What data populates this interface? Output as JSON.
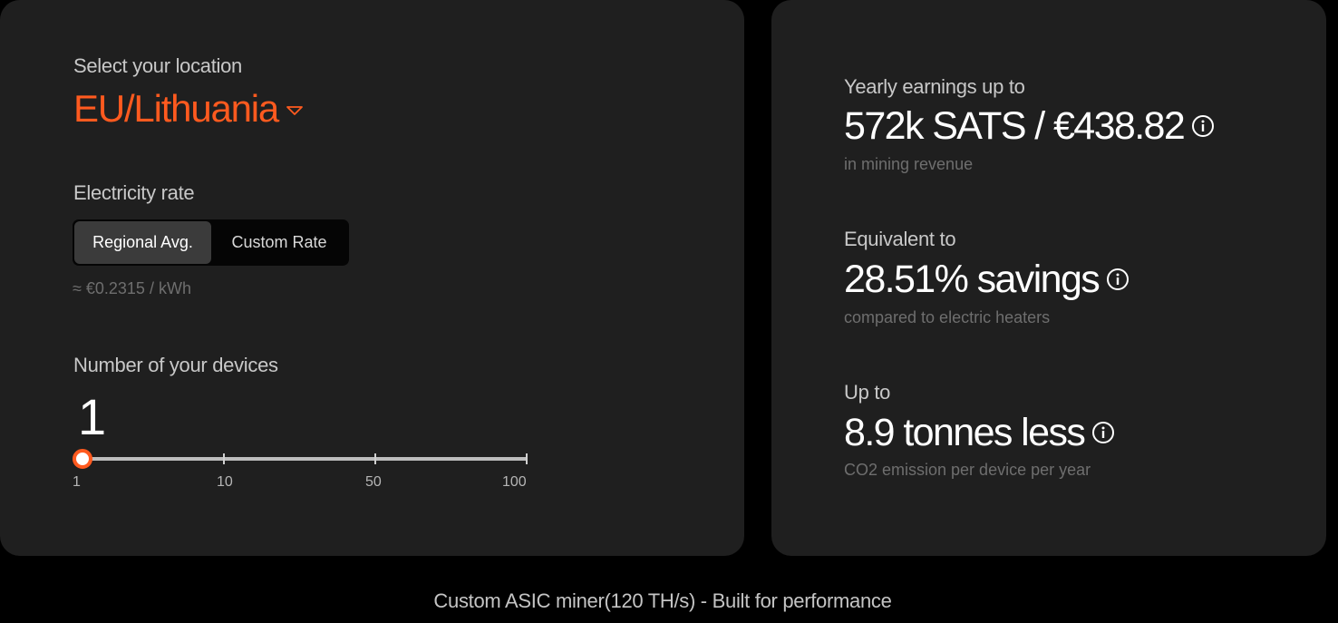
{
  "location": {
    "label": "Select your location",
    "value": "EU/Lithuania"
  },
  "electricity": {
    "label": "Electricity rate",
    "options": [
      {
        "label": "Regional Avg.",
        "active": true
      },
      {
        "label": "Custom Rate",
        "active": false
      }
    ],
    "rate_text": "≈ €0.2315 / kWh"
  },
  "devices": {
    "label": "Number of your devices",
    "count": "1",
    "slider_ticks": [
      "1",
      "10",
      "50",
      "100"
    ]
  },
  "stats": [
    {
      "label": "Yearly earnings up to",
      "value": "572k SATS / €438.82",
      "sub": "in mining revenue"
    },
    {
      "label": "Equivalent to",
      "value": "28.51% savings",
      "sub": "compared to electric heaters"
    },
    {
      "label": "Up to",
      "value": "8.9 tonnes less",
      "sub": "CO2 emission per device per year"
    }
  ],
  "footer": "Custom ASIC miner(120 TH/s) - Built for performance",
  "colors": {
    "accent": "#ff5a1f",
    "background": "#000000",
    "panel": "#1f1f1f"
  },
  "icons": {
    "location_caret": "chevron-down-triangle-icon",
    "info": "info-circle-icon"
  }
}
